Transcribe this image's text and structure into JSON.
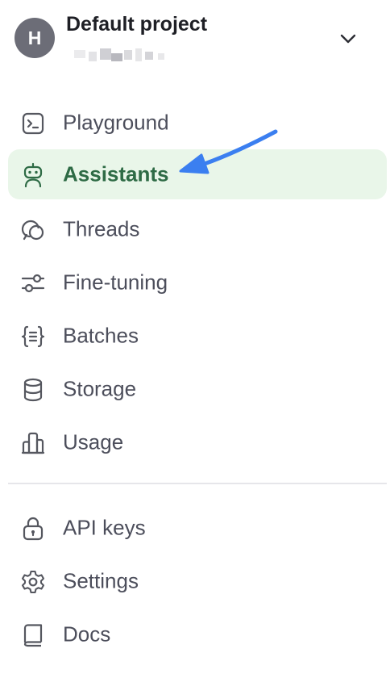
{
  "project": {
    "avatar_letter": "H",
    "name": "Default project"
  },
  "nav_primary": [
    {
      "label": "Playground",
      "icon": "terminal-icon"
    },
    {
      "label": "Assistants",
      "icon": "robot-icon",
      "active": true
    },
    {
      "label": "Threads",
      "icon": "chat-bubbles-icon"
    },
    {
      "label": "Fine-tuning",
      "icon": "sliders-icon"
    },
    {
      "label": "Batches",
      "icon": "braces-list-icon"
    },
    {
      "label": "Storage",
      "icon": "database-icon"
    },
    {
      "label": "Usage",
      "icon": "bar-chart-icon"
    }
  ],
  "nav_secondary": [
    {
      "label": "API keys",
      "icon": "lock-icon"
    },
    {
      "label": "Settings",
      "icon": "gear-icon"
    },
    {
      "label": "Docs",
      "icon": "book-icon"
    }
  ],
  "colors": {
    "active_bg": "#e9f6e9",
    "active_text": "#2e6b45",
    "annotation_arrow": "#3b7ff0"
  }
}
